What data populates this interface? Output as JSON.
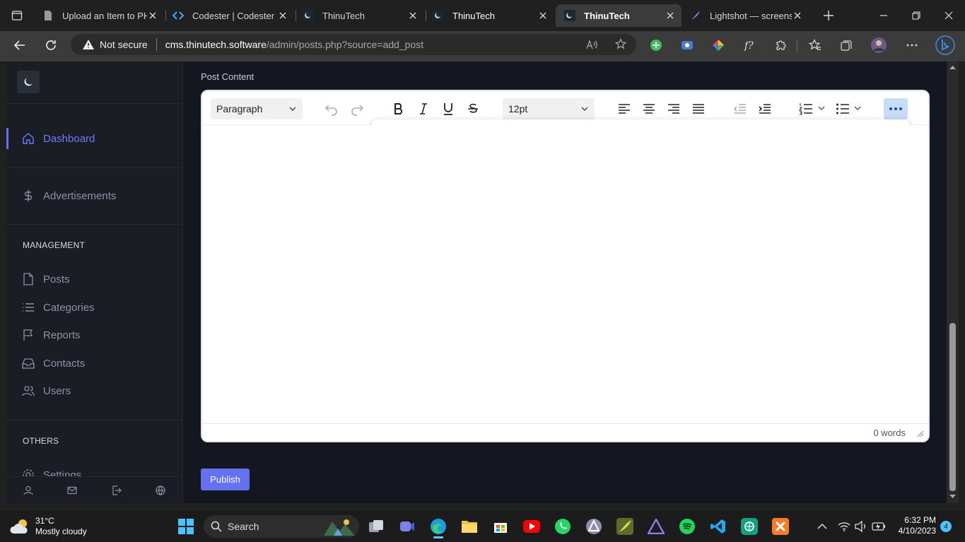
{
  "browser": {
    "tabs": [
      {
        "title": "Upload an Item to PHP"
      },
      {
        "title": "Codester | Codester"
      },
      {
        "title": "ThinuTech"
      },
      {
        "title": "ThinuTech"
      },
      {
        "title": "ThinuTech"
      },
      {
        "title": "Lightshot — screensho"
      }
    ],
    "security_label": "Not secure",
    "url_domain": "cms.thinutech.software",
    "url_path": "/admin/posts.php?source=add_post"
  },
  "sidebar": {
    "items": [
      {
        "label": "Dashboard",
        "icon": "home-icon",
        "active": true
      },
      {
        "label": "Advertisements",
        "icon": "dollar-icon"
      }
    ],
    "management_heading": "MANAGEMENT",
    "management_items": [
      {
        "label": "Posts",
        "icon": "file-icon"
      },
      {
        "label": "Categories",
        "icon": "list-icon"
      },
      {
        "label": "Reports",
        "icon": "flag-icon"
      },
      {
        "label": "Contacts",
        "icon": "inbox-icon"
      },
      {
        "label": "Users",
        "icon": "users-icon"
      }
    ],
    "others_heading": "OTHERS",
    "others_items": [
      {
        "label": "Settings",
        "icon": "gear-icon"
      }
    ],
    "footer_icons": [
      "user-icon",
      "mail-icon",
      "logout-icon",
      "globe-icon"
    ]
  },
  "main": {
    "section_label": "Post Content",
    "editor": {
      "block_format": "Paragraph",
      "font_size": "12pt",
      "word_count": "0 words"
    },
    "publish_label": "Publish"
  },
  "taskbar": {
    "weather_temp": "31°C",
    "weather_desc": "Mostly cloudy",
    "search_label": "Search",
    "time": "6:32 PM",
    "date": "4/10/2023",
    "notification_count": "4"
  },
  "colors": {
    "accent": "#6471f0",
    "sidebar_bg": "#1a1d24",
    "page_bg": "#141720"
  }
}
